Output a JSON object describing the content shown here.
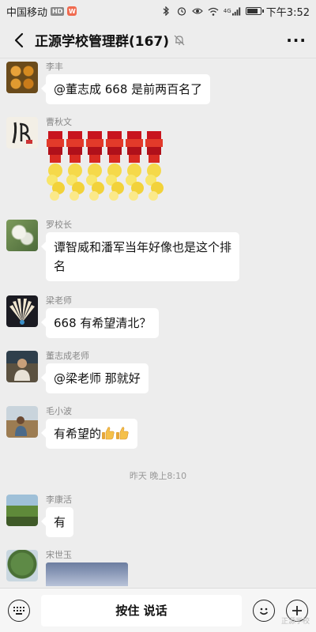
{
  "status_bar": {
    "carrier": "中国移动",
    "hd_badge": "HD",
    "app_badge": "W",
    "signal_indicator": "4G",
    "time": "下午3:52"
  },
  "header": {
    "title": "正源学校管理群(167)",
    "back_icon": "chevron-left-icon",
    "mute_icon": "bell-muted-icon",
    "more_label": "···"
  },
  "messages": [
    {
      "sender": "李丰",
      "text": "@董志成  668 是前两百名了"
    },
    {
      "sender": "曹秋文",
      "sticker": "firecracker-sticker"
    },
    {
      "sender": "罗校长",
      "text_line1": "谭智威和潘军当年好像也是这个排",
      "text_line2": "名"
    },
    {
      "sender": "梁老师",
      "text": "668 有希望清北？"
    },
    {
      "sender": "董志成老师",
      "text": "@梁老师  那就好"
    },
    {
      "sender": "毛小波",
      "text": "有希望的",
      "emoji": "thumbs-up-icon"
    },
    {
      "sender": "李康活",
      "text": "有"
    },
    {
      "sender": "宋世玉",
      "image": "image-message"
    }
  ],
  "time_separator": "昨天 晚上8:10",
  "bottom_bar": {
    "keyboard_icon": "keyboard-icon",
    "hold_to_talk": "按住 说话",
    "emoji_icon": "smiley-icon",
    "add_icon": "plus-icon"
  },
  "watermark": "正源学校",
  "colors": {
    "background": "#ededed",
    "bubble": "#ffffff",
    "sender_text": "#888888"
  }
}
